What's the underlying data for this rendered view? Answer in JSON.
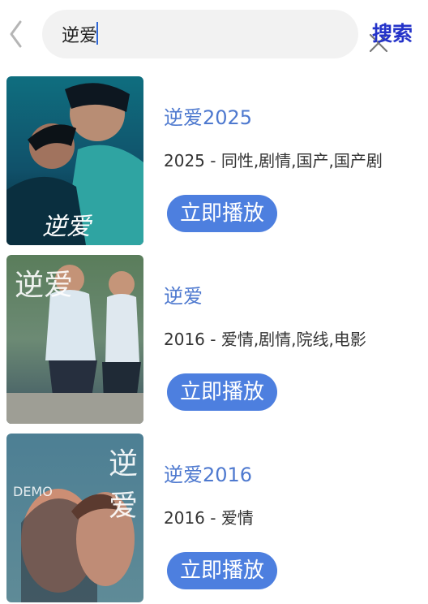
{
  "header": {
    "search_value": "逆爱",
    "search_button": "搜索",
    "icons": [
      "back-icon",
      "clear-icon"
    ]
  },
  "results": [
    {
      "title": "逆爱2025",
      "meta": "2025 - 同性,剧情,国产,国产剧",
      "play_label": "立即播放",
      "poster_text": "逆爱"
    },
    {
      "title": "逆爱",
      "meta": "2016 - 爱情,剧情,院线,电影",
      "play_label": "立即播放",
      "poster_text": "逆爱"
    },
    {
      "title": "逆爱2016",
      "meta": "2016 - 爱情",
      "play_label": "立即播放",
      "poster_text": "DEMO"
    }
  ],
  "colors": {
    "accent": "#4d7fdf",
    "title": "#4e79cf",
    "search_button": "#2433c9"
  }
}
